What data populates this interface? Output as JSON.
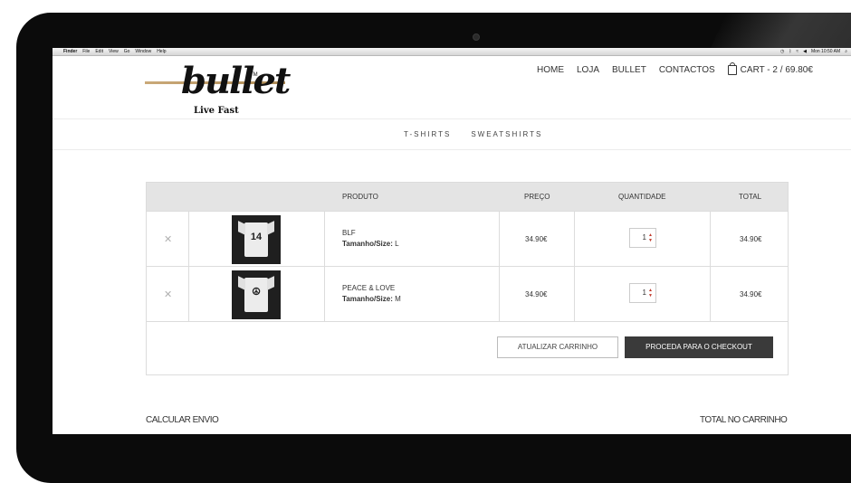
{
  "menubar": {
    "apple": "",
    "items": [
      "Finder",
      "File",
      "Edit",
      "View",
      "Go",
      "Window",
      "Help"
    ],
    "clock": "Mon 10:50 AM"
  },
  "header": {
    "logo_word": "bullet",
    "logo_tm": "TM",
    "logo_tagline": "Live Fast",
    "nav": [
      "HOME",
      "LOJA",
      "BULLET",
      "CONTACTOS"
    ],
    "cart": "CART - 2 / 69.80€"
  },
  "subnav": [
    "T-SHIRTS",
    "SWEATSHIRTS"
  ],
  "table": {
    "headers": {
      "produto": "PRODUTO",
      "preco": "PREÇO",
      "quantidade": "QUANTIDADE",
      "total": "TOTAL"
    },
    "rows": [
      {
        "name": "BLF",
        "size_label": "Tamanho/Size:",
        "size": "L",
        "price": "34.90€",
        "qty": "1",
        "total": "34.90€",
        "print": "14"
      },
      {
        "name": "PEACE & LOVE",
        "size_label": "Tamanho/Size:",
        "size": "M",
        "price": "34.90€",
        "qty": "1",
        "total": "34.90€",
        "print": "☮"
      }
    ],
    "update_button": "ATUALIZAR CARRINHO",
    "checkout_button": "PROCEDA PARA O CHECKOUT"
  },
  "footer": {
    "calc_shipping": "CALCULAR ENVIO",
    "cart_total": "TOTAL NO CARRINHO"
  },
  "colors": {
    "accent_gold": "#b08d57",
    "checkout_bg": "#3a3a3a",
    "qty_arrows": "#c0392b"
  }
}
